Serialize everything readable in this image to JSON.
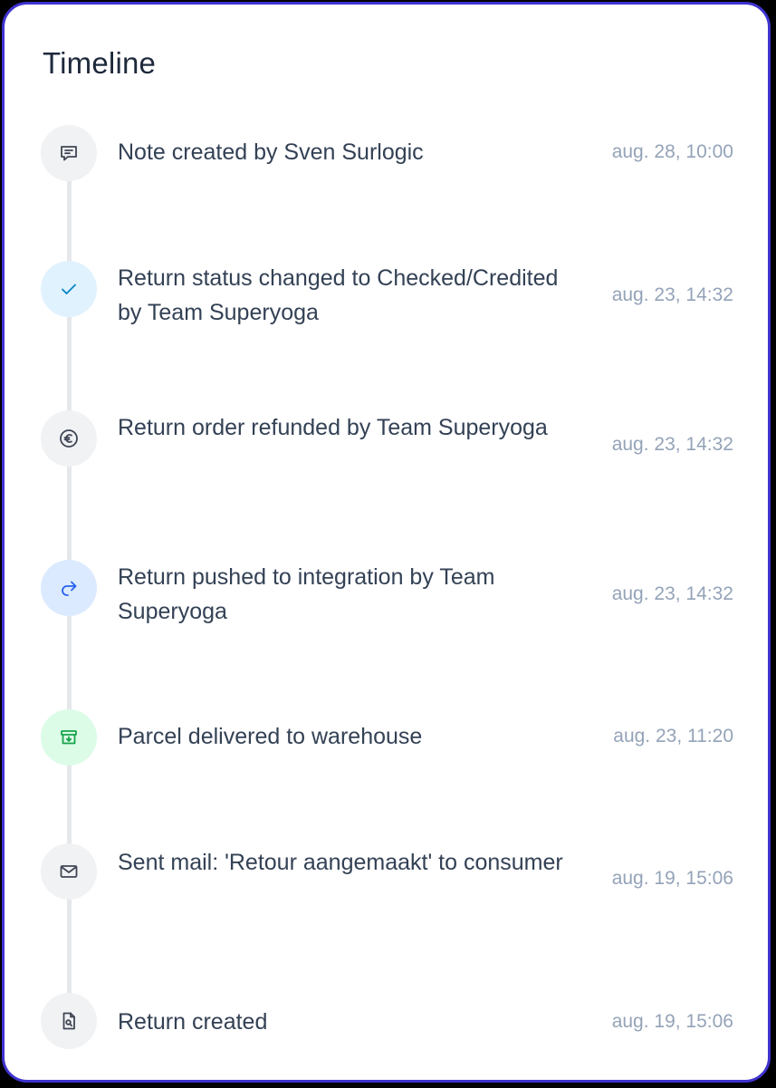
{
  "timeline": {
    "title": "Timeline",
    "events": [
      {
        "label": "Note created by Sven Surlogic",
        "time": "aug. 28, 10:00",
        "icon": "note-icon"
      },
      {
        "label": "Return status changed to Checked/Credited by Team Superyoga",
        "time": "aug. 23, 14:32",
        "icon": "check-icon"
      },
      {
        "label": "Return order refunded by Team Superyoga",
        "time": "aug. 23, 14:32",
        "icon": "euro-icon"
      },
      {
        "label": "Return pushed to integration by Team Superyoga",
        "time": "aug. 23, 14:32",
        "icon": "forward-arrow-icon"
      },
      {
        "label": "Parcel delivered to warehouse",
        "time": "aug. 23, 11:20",
        "icon": "archive-icon"
      },
      {
        "label": "Sent mail: 'Retour aangemaakt' to consumer",
        "time": "aug. 19, 15:06",
        "icon": "mail-icon"
      },
      {
        "label": "Return created",
        "time": "aug. 19, 15:06",
        "icon": "document-search-icon"
      }
    ]
  },
  "colors": {
    "border": "#3f33cf",
    "title": "#1e293b",
    "text": "#334155",
    "muted": "#94a3b8",
    "connector": "#e5e7eb",
    "icon_gray_bg": "#f1f2f4",
    "icon_sky_bg": "#e0f2fe",
    "icon_blue_bg": "#dbeafe",
    "icon_green_bg": "#dcfce7"
  }
}
